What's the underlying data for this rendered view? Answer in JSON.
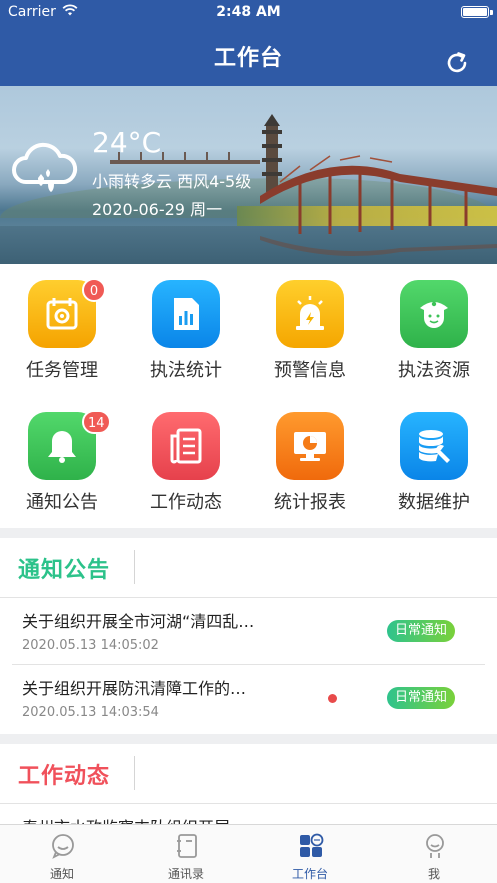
{
  "status_bar": {
    "carrier": "Carrier",
    "time": "2:48 AM"
  },
  "nav": {
    "title": "工作台"
  },
  "weather": {
    "temperature": "24°C",
    "condition": "小雨转多云  西风4-5级",
    "date": "2020-06-29  周一",
    "icon": "cloud-rain-icon"
  },
  "grid": {
    "items": [
      {
        "label": "任务管理",
        "icon": "task-calendar-icon",
        "color": "#f7b500",
        "badge": "0"
      },
      {
        "label": "执法统计",
        "icon": "statistics-doc-icon",
        "color": "#1a9cf0",
        "badge": ""
      },
      {
        "label": "预警信息",
        "icon": "alarm-light-icon",
        "color": "#f5b400",
        "badge": ""
      },
      {
        "label": "执法资源",
        "icon": "officer-icon",
        "color": "#3cc257",
        "badge": ""
      },
      {
        "label": "通知公告",
        "icon": "bell-icon",
        "color": "#3cc257",
        "badge": "14"
      },
      {
        "label": "工作动态",
        "icon": "news-doc-icon",
        "color": "#f0515b",
        "badge": ""
      },
      {
        "label": "统计报表",
        "icon": "report-monitor-icon",
        "color": "#f57b17",
        "badge": ""
      },
      {
        "label": "数据维护",
        "icon": "database-wrench-icon",
        "color": "#1a9cf0",
        "badge": ""
      }
    ]
  },
  "notices": {
    "title": "通知公告",
    "title_color": "#2cc28a",
    "items": [
      {
        "title": "关于组织开展全市河湖“清四乱…",
        "time": "2020.05.13 14:05:02",
        "tag": "日常通知",
        "unread": false
      },
      {
        "title": "关于组织开展防汛清障工作的…",
        "time": "2020.05.13 14:03:54",
        "tag": "日常通知",
        "unread": true
      }
    ]
  },
  "work_news": {
    "title": "工作动态",
    "title_color": "#f0515b",
    "first_item": "泰州市水政监察支队组织开展"
  },
  "tabs": [
    {
      "label": "通知",
      "icon": "chat-bubble-icon",
      "active": false
    },
    {
      "label": "通讯录",
      "icon": "address-book-icon",
      "active": false
    },
    {
      "label": "工作台",
      "icon": "dashboard-grid-icon",
      "active": true
    },
    {
      "label": "我",
      "icon": "person-icon",
      "active": false
    }
  ],
  "colors": {
    "primary": "#2f5aa6",
    "tag_gradient": [
      "#2fc38d",
      "#7ad13a"
    ],
    "badge": "#f05a55"
  }
}
